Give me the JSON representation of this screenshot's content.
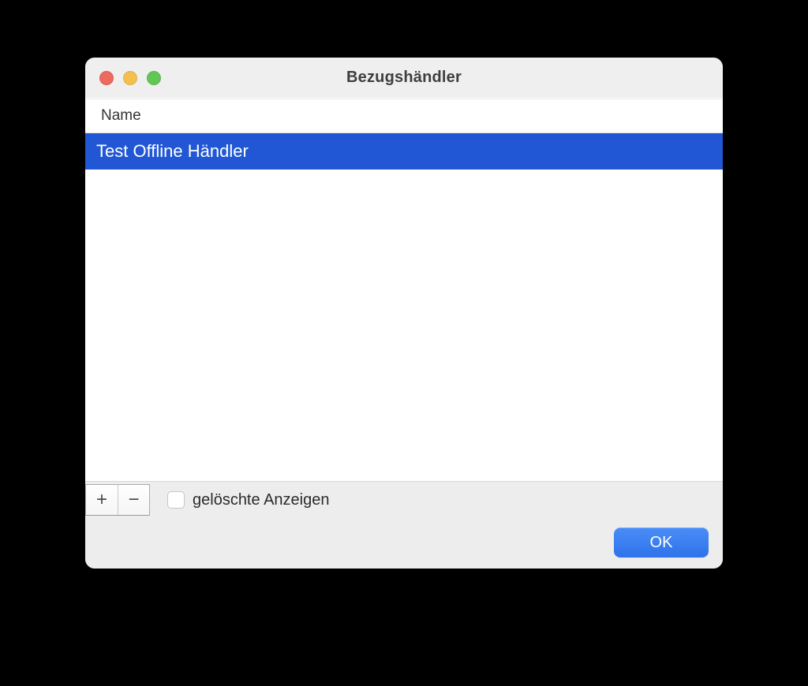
{
  "window": {
    "title": "Bezugshändler"
  },
  "table": {
    "columns": {
      "name": "Name"
    },
    "rows": [
      {
        "name": "Test Offline Händler",
        "selected": true
      }
    ]
  },
  "toolbar": {
    "add_label": "+",
    "remove_label": "−",
    "show_deleted_label": "gelöschte Anzeigen",
    "show_deleted_checked": false
  },
  "actions": {
    "ok_label": "OK"
  },
  "colors": {
    "selection": "#2157d5",
    "primary_button": "#3a7df0"
  }
}
